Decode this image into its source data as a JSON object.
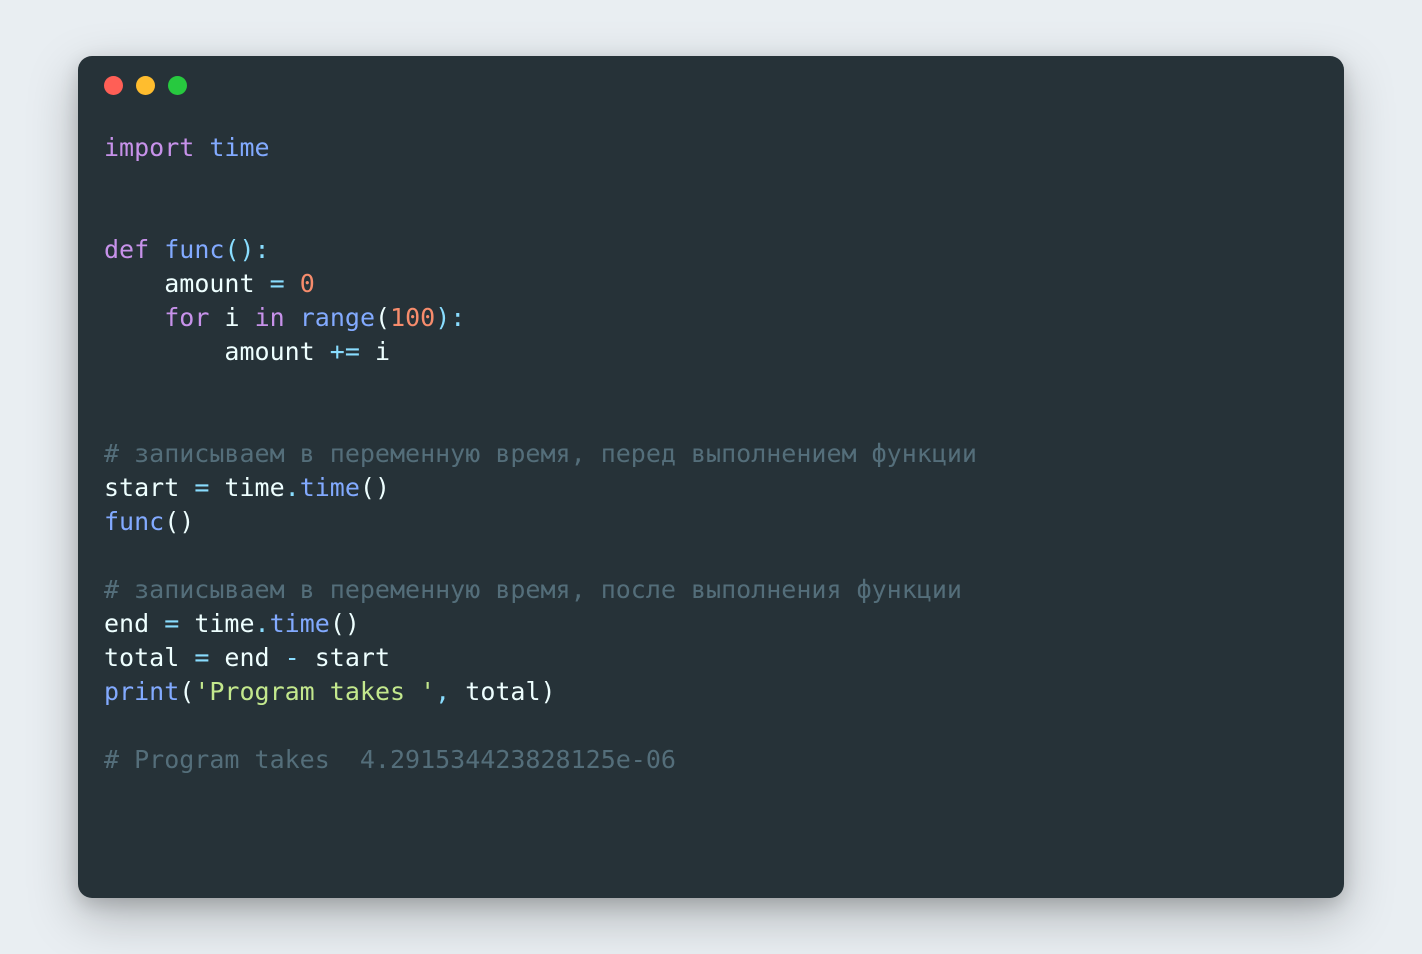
{
  "code": {
    "l1": {
      "import": "import",
      "time": "time"
    },
    "l3": {
      "def": "def",
      "func": "func",
      "parens": "():"
    },
    "l4": {
      "indent": "    ",
      "amount": "amount",
      "eq": " = ",
      "zero": "0"
    },
    "l5": {
      "indent": "    ",
      "for": "for",
      "i": "i",
      "in": "in",
      "range": "range",
      "open": "(",
      "hundred": "100",
      "close": "):"
    },
    "l6": {
      "indent": "        ",
      "amount": "amount",
      "op": " += ",
      "i": "i"
    },
    "l8": {
      "comment": "# записываем в переменную время, перед выполнением функции"
    },
    "l9": {
      "start": "start",
      "eq": " = ",
      "time1": "time",
      "dot": ".",
      "time2": "time",
      "parens": "()"
    },
    "l10": {
      "func": "func",
      "parens": "()"
    },
    "l12": {
      "comment": "# записываем в переменную время, после выполнения функции"
    },
    "l13": {
      "end": "end",
      "eq": " = ",
      "time1": "time",
      "dot": ".",
      "time2": "time",
      "parens": "()"
    },
    "l14": {
      "total": "total",
      "eq": " = ",
      "end": "end",
      "minus": " - ",
      "start": "start"
    },
    "l15": {
      "print": "print",
      "open": "(",
      "str": "'Program takes '",
      "comma": ", ",
      "total": "total",
      "close": ")"
    },
    "l17": {
      "comment": "# Program takes  4.291534423828125e-06"
    }
  }
}
